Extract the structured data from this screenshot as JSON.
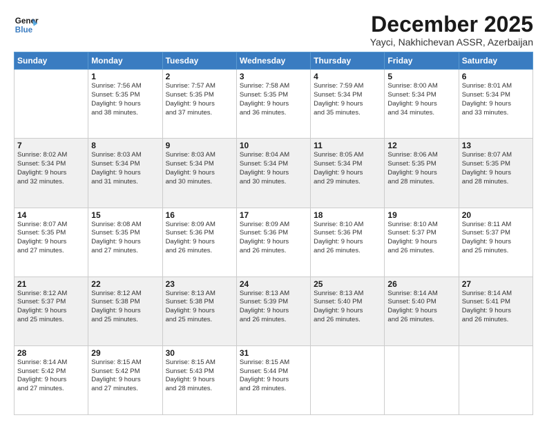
{
  "header": {
    "logo_line1": "General",
    "logo_line2": "Blue",
    "month_title": "December 2025",
    "location": "Yayci, Nakhichevan ASSR, Azerbaijan"
  },
  "weekdays": [
    "Sunday",
    "Monday",
    "Tuesday",
    "Wednesday",
    "Thursday",
    "Friday",
    "Saturday"
  ],
  "weeks": [
    [
      {
        "day": "",
        "info": ""
      },
      {
        "day": "1",
        "info": "Sunrise: 7:56 AM\nSunset: 5:35 PM\nDaylight: 9 hours\nand 38 minutes."
      },
      {
        "day": "2",
        "info": "Sunrise: 7:57 AM\nSunset: 5:35 PM\nDaylight: 9 hours\nand 37 minutes."
      },
      {
        "day": "3",
        "info": "Sunrise: 7:58 AM\nSunset: 5:35 PM\nDaylight: 9 hours\nand 36 minutes."
      },
      {
        "day": "4",
        "info": "Sunrise: 7:59 AM\nSunset: 5:34 PM\nDaylight: 9 hours\nand 35 minutes."
      },
      {
        "day": "5",
        "info": "Sunrise: 8:00 AM\nSunset: 5:34 PM\nDaylight: 9 hours\nand 34 minutes."
      },
      {
        "day": "6",
        "info": "Sunrise: 8:01 AM\nSunset: 5:34 PM\nDaylight: 9 hours\nand 33 minutes."
      }
    ],
    [
      {
        "day": "7",
        "info": "Sunrise: 8:02 AM\nSunset: 5:34 PM\nDaylight: 9 hours\nand 32 minutes."
      },
      {
        "day": "8",
        "info": "Sunrise: 8:03 AM\nSunset: 5:34 PM\nDaylight: 9 hours\nand 31 minutes."
      },
      {
        "day": "9",
        "info": "Sunrise: 8:03 AM\nSunset: 5:34 PM\nDaylight: 9 hours\nand 30 minutes."
      },
      {
        "day": "10",
        "info": "Sunrise: 8:04 AM\nSunset: 5:34 PM\nDaylight: 9 hours\nand 30 minutes."
      },
      {
        "day": "11",
        "info": "Sunrise: 8:05 AM\nSunset: 5:34 PM\nDaylight: 9 hours\nand 29 minutes."
      },
      {
        "day": "12",
        "info": "Sunrise: 8:06 AM\nSunset: 5:35 PM\nDaylight: 9 hours\nand 28 minutes."
      },
      {
        "day": "13",
        "info": "Sunrise: 8:07 AM\nSunset: 5:35 PM\nDaylight: 9 hours\nand 28 minutes."
      }
    ],
    [
      {
        "day": "14",
        "info": "Sunrise: 8:07 AM\nSunset: 5:35 PM\nDaylight: 9 hours\nand 27 minutes."
      },
      {
        "day": "15",
        "info": "Sunrise: 8:08 AM\nSunset: 5:35 PM\nDaylight: 9 hours\nand 27 minutes."
      },
      {
        "day": "16",
        "info": "Sunrise: 8:09 AM\nSunset: 5:36 PM\nDaylight: 9 hours\nand 26 minutes."
      },
      {
        "day": "17",
        "info": "Sunrise: 8:09 AM\nSunset: 5:36 PM\nDaylight: 9 hours\nand 26 minutes."
      },
      {
        "day": "18",
        "info": "Sunrise: 8:10 AM\nSunset: 5:36 PM\nDaylight: 9 hours\nand 26 minutes."
      },
      {
        "day": "19",
        "info": "Sunrise: 8:10 AM\nSunset: 5:37 PM\nDaylight: 9 hours\nand 26 minutes."
      },
      {
        "day": "20",
        "info": "Sunrise: 8:11 AM\nSunset: 5:37 PM\nDaylight: 9 hours\nand 25 minutes."
      }
    ],
    [
      {
        "day": "21",
        "info": "Sunrise: 8:12 AM\nSunset: 5:37 PM\nDaylight: 9 hours\nand 25 minutes."
      },
      {
        "day": "22",
        "info": "Sunrise: 8:12 AM\nSunset: 5:38 PM\nDaylight: 9 hours\nand 25 minutes."
      },
      {
        "day": "23",
        "info": "Sunrise: 8:13 AM\nSunset: 5:38 PM\nDaylight: 9 hours\nand 25 minutes."
      },
      {
        "day": "24",
        "info": "Sunrise: 8:13 AM\nSunset: 5:39 PM\nDaylight: 9 hours\nand 26 minutes."
      },
      {
        "day": "25",
        "info": "Sunrise: 8:13 AM\nSunset: 5:40 PM\nDaylight: 9 hours\nand 26 minutes."
      },
      {
        "day": "26",
        "info": "Sunrise: 8:14 AM\nSunset: 5:40 PM\nDaylight: 9 hours\nand 26 minutes."
      },
      {
        "day": "27",
        "info": "Sunrise: 8:14 AM\nSunset: 5:41 PM\nDaylight: 9 hours\nand 26 minutes."
      }
    ],
    [
      {
        "day": "28",
        "info": "Sunrise: 8:14 AM\nSunset: 5:42 PM\nDaylight: 9 hours\nand 27 minutes."
      },
      {
        "day": "29",
        "info": "Sunrise: 8:15 AM\nSunset: 5:42 PM\nDaylight: 9 hours\nand 27 minutes."
      },
      {
        "day": "30",
        "info": "Sunrise: 8:15 AM\nSunset: 5:43 PM\nDaylight: 9 hours\nand 28 minutes."
      },
      {
        "day": "31",
        "info": "Sunrise: 8:15 AM\nSunset: 5:44 PM\nDaylight: 9 hours\nand 28 minutes."
      },
      {
        "day": "",
        "info": ""
      },
      {
        "day": "",
        "info": ""
      },
      {
        "day": "",
        "info": ""
      }
    ]
  ]
}
